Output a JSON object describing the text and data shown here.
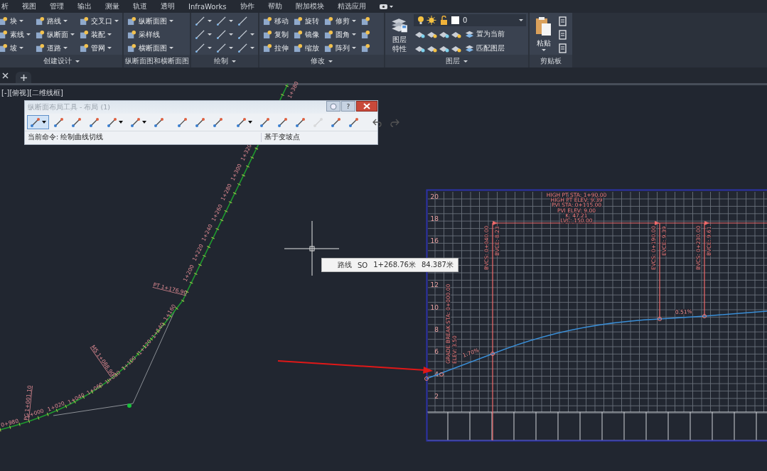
{
  "menu": [
    "析",
    "视图",
    "管理",
    "输出",
    "测量",
    "轨道",
    "透明",
    "InfraWorks",
    "协作",
    "帮助",
    "附加模块",
    "精选应用"
  ],
  "ribbon": {
    "panels": [
      {
        "kind": "buttons",
        "title": "创建设计",
        "caret": true,
        "columns": [
          [
            {
              "label": "块",
              "caret": true
            },
            {
              "label": "素线",
              "caret": true
            },
            {
              "label": "坡",
              "caret": true
            }
          ],
          [
            {
              "label": "路线",
              "caret": true
            },
            {
              "label": "纵断面",
              "caret": true
            },
            {
              "label": "道路",
              "caret": true
            }
          ],
          [
            {
              "label": "交叉口",
              "caret": true
            },
            {
              "label": "装配",
              "caret": true
            },
            {
              "label": "管网",
              "caret": true
            }
          ]
        ]
      },
      {
        "kind": "buttons",
        "title": "纵断面图和横断面图",
        "caret": false,
        "columns": [
          [
            {
              "label": "纵断面图",
              "caret": true
            },
            {
              "label": "采样线",
              "caret": false
            },
            {
              "label": "横断面图",
              "caret": true
            }
          ]
        ]
      },
      {
        "kind": "draw",
        "title": "绘制",
        "caret": true,
        "tools": [
          {
            "caret": true
          },
          {
            "caret": true
          },
          {
            "caret": false
          },
          {
            "caret": true
          },
          {
            "caret": true
          },
          {
            "caret": true
          },
          {
            "caret": true
          },
          {
            "caret": true
          },
          {
            "caret": true
          }
        ]
      },
      {
        "kind": "buttons",
        "title": "修改",
        "caret": true,
        "columns": [
          [
            {
              "label": "移动",
              "caret": false
            },
            {
              "label": "复制",
              "caret": false
            },
            {
              "label": "拉伸",
              "caret": false
            }
          ],
          [
            {
              "label": "旋转",
              "caret": false
            },
            {
              "label": "镜像",
              "caret": false
            },
            {
              "label": "缩放",
              "caret": false
            }
          ],
          [
            {
              "label": "修剪",
              "caret": true
            },
            {
              "label": "圆角",
              "caret": true
            },
            {
              "label": "阵列",
              "caret": true
            }
          ],
          [
            {
              "caret": false
            },
            {
              "caret": false
            },
            {
              "caret": false
            }
          ]
        ]
      },
      {
        "kind": "layers",
        "title": "图层",
        "caret": true,
        "big_label": "图层特性",
        "layer_value": "0",
        "actions": [
          "置为当前",
          "匹配图层"
        ]
      },
      {
        "kind": "clipboard",
        "title": "剪贴板",
        "caret": false,
        "big_label": "粘贴",
        "big_caret": true
      }
    ]
  },
  "viewport_label": "[-][俯视][二维线框]",
  "toolbar_window": {
    "title": "纵断面布局工具 - 布局 (1)",
    "help": "?",
    "tools": [
      {
        "kind": "tool",
        "caret": true,
        "selected": true,
        "disabled": false
      },
      {
        "kind": "tool",
        "caret": false,
        "selected": false,
        "disabled": false
      },
      {
        "kind": "tool",
        "caret": false,
        "selected": false,
        "disabled": false
      },
      {
        "kind": "tool",
        "caret": false,
        "selected": false,
        "disabled": false
      },
      {
        "kind": "tool",
        "caret": true,
        "selected": false,
        "disabled": false
      },
      {
        "kind": "tool",
        "caret": true,
        "selected": false,
        "disabled": false
      },
      {
        "kind": "tool",
        "caret": false,
        "selected": false,
        "disabled": false
      },
      {
        "kind": "separator"
      },
      {
        "kind": "tool",
        "caret": false,
        "selected": false,
        "disabled": false
      },
      {
        "kind": "tool",
        "caret": false,
        "selected": false,
        "disabled": false
      },
      {
        "kind": "tool",
        "caret": false,
        "selected": false,
        "disabled": false
      },
      {
        "kind": "separator"
      },
      {
        "kind": "tool",
        "caret": true,
        "selected": false,
        "disabled": false
      },
      {
        "kind": "tool",
        "caret": false,
        "selected": false,
        "disabled": false
      },
      {
        "kind": "tool",
        "caret": false,
        "selected": false,
        "disabled": false
      },
      {
        "kind": "tool",
        "caret": false,
        "selected": false,
        "disabled": false
      },
      {
        "kind": "tool",
        "caret": false,
        "selected": false,
        "disabled": true
      },
      {
        "kind": "tool",
        "caret": false,
        "selected": false,
        "disabled": false
      },
      {
        "kind": "tool",
        "caret": false,
        "selected": false,
        "disabled": false
      },
      {
        "kind": "separator"
      },
      {
        "kind": "undo"
      },
      {
        "kind": "redo"
      }
    ],
    "command": "当前命令: 绘制曲线切线",
    "mode": "基于变坡点"
  },
  "tooltip": {
    "parts": [
      "路线",
      "SO",
      "1+268.76米",
      "84.387米"
    ]
  },
  "alignment": {
    "stations": [
      "0+980",
      "1+000",
      "1+020",
      "1+040",
      "1+060",
      "1+080",
      "1+100",
      "1+120",
      "1+140",
      "1+160",
      "1+200",
      "1+220",
      "1+240",
      "1+260",
      "1+280",
      "1+300",
      "1+320",
      "1+380"
    ],
    "geometry_labels": [
      "PC 1+001.10",
      "MS 1+088.90",
      "PT 1+176.90"
    ]
  },
  "profile": {
    "y_labels": [
      "20",
      "18",
      "16",
      "12",
      "10",
      "8",
      "6",
      "4",
      "2"
    ],
    "pvi_labels": [
      "HIGH PT STA: 1+90.00",
      "HIGH PT ELEV: 9.39",
      "PVI STA: 0+115.00",
      "PVI ELEV: 9.00",
      "K: 47.21",
      "LVC: 150.00"
    ],
    "curve_labels": [
      {
        "station": "BVCS: 0+040.00",
        "elev": "BVCE: 8.23"
      },
      {
        "station": "EVCS: 0+190.00",
        "elev": "EVCE: 9.39"
      },
      {
        "station": "BVCS: 0+230.00",
        "elev": "BVCE: 9.61"
      }
    ],
    "grade_labels": [
      "1.70%",
      "0.51%"
    ],
    "grade_break_labels": [
      "GRADE BREAK STA: 0+000.00",
      "ELEV: 3.50"
    ]
  }
}
